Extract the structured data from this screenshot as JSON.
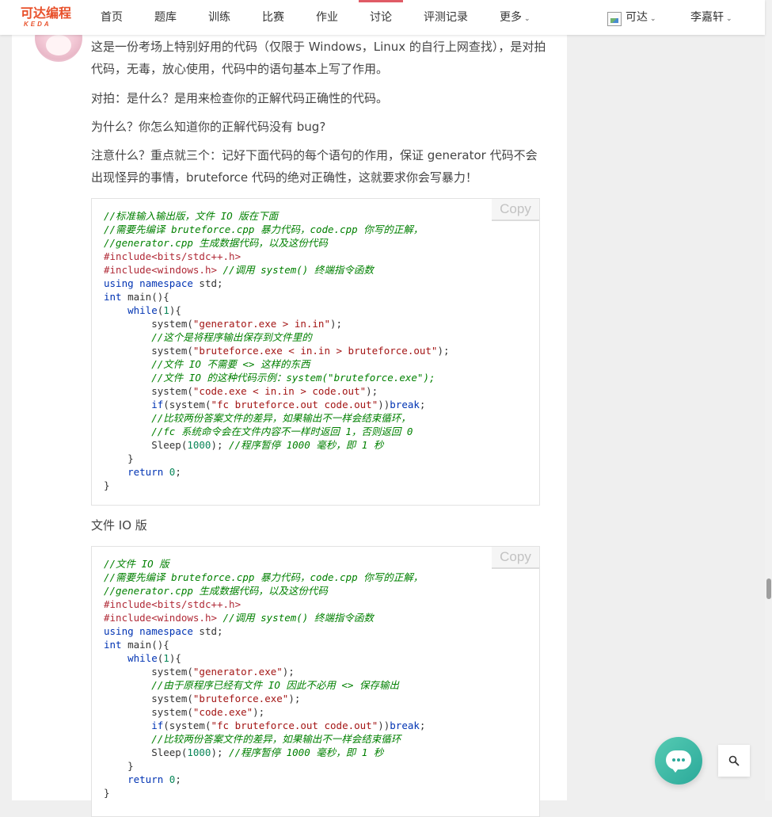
{
  "nav": {
    "logo_cn": "可达编程",
    "logo_en": "KEDA",
    "items": [
      {
        "label": "首页"
      },
      {
        "label": "题库"
      },
      {
        "label": "训练"
      },
      {
        "label": "比赛"
      },
      {
        "label": "作业"
      },
      {
        "label": "讨论",
        "active": true
      },
      {
        "label": "评测记录"
      },
      {
        "label": "更多"
      }
    ],
    "account": "可达",
    "user": "李嘉轩",
    "accent": "#e05b66"
  },
  "post": {
    "p1": "这是一份考场上特别好用的代码（仅限于 Windows，Linux 的自行上网查找），是对拍代码，无毒，放心使用，代码中的语句基本上写了作用。",
    "p2": "对拍：是什么？是用来检查你的正解代码正确性的代码。",
    "p3": "为什么？你怎么知道你的正解代码没有 bug?",
    "p4": "注意什么？重点就三个：记好下面代码的每个语句的作用，保证 generator 代码不会出现怪异的事情，bruteforce 代码的绝对正确性，这就要求你会写暴力！",
    "p5": "文件 IO 版",
    "copy_label": "Copy",
    "code1": [
      [
        {
          "t": "//标准输入输出版，文件 IO 版在下面",
          "c": "com"
        }
      ],
      [
        {
          "t": "//需要先编译 bruteforce.cpp 暴力代码，code.cpp 你写的正解，",
          "c": "com"
        }
      ],
      [
        {
          "t": "//generator.cpp 生成数据代码，以及这份代码",
          "c": "com"
        }
      ],
      [
        {
          "t": "#include",
          "c": "pre"
        },
        {
          "t": "<bits/stdc++.h>",
          "c": "pre"
        }
      ],
      [
        {
          "t": "#include",
          "c": "pre"
        },
        {
          "t": "<windows.h>",
          "c": "pre"
        },
        {
          "t": " "
        },
        {
          "t": "//调用 system() 终端指令函数",
          "c": "com"
        }
      ],
      [
        {
          "t": "using",
          "c": "kw"
        },
        {
          "t": " "
        },
        {
          "t": "namespace",
          "c": "kw"
        },
        {
          "t": " std;"
        }
      ],
      [
        {
          "t": "int",
          "c": "kw"
        },
        {
          "t": " main(){"
        }
      ],
      [
        {
          "t": "    "
        },
        {
          "t": "while",
          "c": "kw"
        },
        {
          "t": "("
        },
        {
          "t": "1",
          "c": "num"
        },
        {
          "t": "){"
        }
      ],
      [
        {
          "t": "        system("
        },
        {
          "t": "\"generator.exe > in.in\"",
          "c": "str"
        },
        {
          "t": ");"
        }
      ],
      [
        {
          "t": "        "
        },
        {
          "t": "//这个是将程序输出保存到文件里的",
          "c": "com"
        }
      ],
      [
        {
          "t": "        system("
        },
        {
          "t": "\"bruteforce.exe < in.in > bruteforce.out\"",
          "c": "str"
        },
        {
          "t": ");"
        }
      ],
      [
        {
          "t": "        "
        },
        {
          "t": "//文件 IO 不需要 <> 这样的东西",
          "c": "com"
        }
      ],
      [
        {
          "t": "        "
        },
        {
          "t": "//文件 IO 的这种代码示例：system(\"bruteforce.exe\");",
          "c": "com"
        }
      ],
      [
        {
          "t": "        system("
        },
        {
          "t": "\"code.exe < in.in > code.out\"",
          "c": "str"
        },
        {
          "t": ");"
        }
      ],
      [
        {
          "t": "        "
        },
        {
          "t": "if",
          "c": "kw"
        },
        {
          "t": "(system("
        },
        {
          "t": "\"fc bruteforce.out code.out\"",
          "c": "str"
        },
        {
          "t": "))"
        },
        {
          "t": "break",
          "c": "kw"
        },
        {
          "t": ";"
        }
      ],
      [
        {
          "t": "        "
        },
        {
          "t": "//比较两份答案文件的差异，如果输出不一样会结束循环，",
          "c": "com"
        }
      ],
      [
        {
          "t": "        "
        },
        {
          "t": "//fc 系统命令会在文件内容不一样时返回 1，否则返回 0",
          "c": "com"
        }
      ],
      [
        {
          "t": "        Sleep("
        },
        {
          "t": "1000",
          "c": "num"
        },
        {
          "t": "); "
        },
        {
          "t": "//程序暂停 1000 毫秒，即 1 秒",
          "c": "com"
        }
      ],
      [
        {
          "t": "    }"
        }
      ],
      [
        {
          "t": "    "
        },
        {
          "t": "return",
          "c": "kw"
        },
        {
          "t": " "
        },
        {
          "t": "0",
          "c": "num"
        },
        {
          "t": ";"
        }
      ],
      [
        {
          "t": "}"
        }
      ]
    ],
    "code2": [
      [
        {
          "t": "//文件 IO 版",
          "c": "com"
        }
      ],
      [
        {
          "t": "//需要先编译 bruteforce.cpp 暴力代码，code.cpp 你写的正解，",
          "c": "com"
        }
      ],
      [
        {
          "t": "//generator.cpp 生成数据代码，以及这份代码",
          "c": "com"
        }
      ],
      [
        {
          "t": "#include",
          "c": "pre"
        },
        {
          "t": "<bits/stdc++.h>",
          "c": "pre"
        }
      ],
      [
        {
          "t": "#include",
          "c": "pre"
        },
        {
          "t": "<windows.h>",
          "c": "pre"
        },
        {
          "t": " "
        },
        {
          "t": "//调用 system() 终端指令函数",
          "c": "com"
        }
      ],
      [
        {
          "t": "using",
          "c": "kw"
        },
        {
          "t": " "
        },
        {
          "t": "namespace",
          "c": "kw"
        },
        {
          "t": " std;"
        }
      ],
      [
        {
          "t": "int",
          "c": "kw"
        },
        {
          "t": " main(){"
        }
      ],
      [
        {
          "t": "    "
        },
        {
          "t": "while",
          "c": "kw"
        },
        {
          "t": "("
        },
        {
          "t": "1",
          "c": "num"
        },
        {
          "t": "){"
        }
      ],
      [
        {
          "t": "        system("
        },
        {
          "t": "\"generator.exe\"",
          "c": "str"
        },
        {
          "t": ");"
        }
      ],
      [
        {
          "t": "        "
        },
        {
          "t": "//由于原程序已经有文件 IO 因此不必用 <> 保存输出",
          "c": "com"
        }
      ],
      [
        {
          "t": "        system("
        },
        {
          "t": "\"bruteforce.exe\"",
          "c": "str"
        },
        {
          "t": ");"
        }
      ],
      [
        {
          "t": "        system("
        },
        {
          "t": "\"code.exe\"",
          "c": "str"
        },
        {
          "t": ");"
        }
      ],
      [
        {
          "t": "        "
        },
        {
          "t": "if",
          "c": "kw"
        },
        {
          "t": "(system("
        },
        {
          "t": "\"fc bruteforce.out code.out\"",
          "c": "str"
        },
        {
          "t": "))"
        },
        {
          "t": "break",
          "c": "kw"
        },
        {
          "t": ";"
        }
      ],
      [
        {
          "t": "        "
        },
        {
          "t": "//比较两份答案文件的差异，如果输出不一样会结束循环",
          "c": "com"
        }
      ],
      [
        {
          "t": "        Sleep("
        },
        {
          "t": "1000",
          "c": "num"
        },
        {
          "t": "); "
        },
        {
          "t": "//程序暂停 1000 毫秒，即 1 秒",
          "c": "com"
        }
      ],
      [
        {
          "t": "    }"
        }
      ],
      [
        {
          "t": "    "
        },
        {
          "t": "return",
          "c": "kw"
        },
        {
          "t": " "
        },
        {
          "t": "0",
          "c": "num"
        },
        {
          "t": ";"
        }
      ],
      [
        {
          "t": "}"
        }
      ]
    ]
  },
  "icons": {
    "chat": "chat-bubble-icon",
    "search": "search-icon",
    "chat_color": "#2ba99a"
  }
}
